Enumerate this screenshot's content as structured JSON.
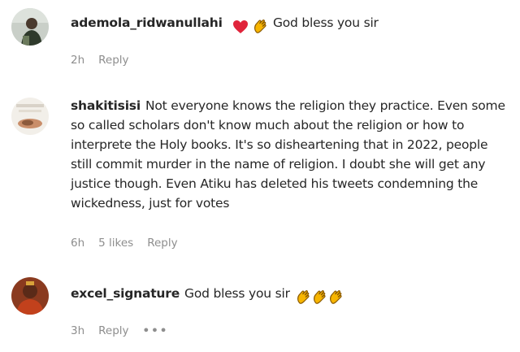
{
  "comments": [
    {
      "username": "ademola_ridwanullahi",
      "text": "God bless you sir",
      "time": "2h",
      "reply": "Reply"
    },
    {
      "username": "shakitisisi",
      "text": "Not everyone knows the religion they practice. Even some so called scholars don't know much about the religion or how to interprete the Holy books. It's so disheartening that in 2022, people still commit murder in the name of religion. I doubt she will get any justice though. Even Atiku has deleted his tweets condemning the wickedness, just for votes",
      "time": "6h",
      "likes": "5 likes",
      "reply": "Reply"
    },
    {
      "username": "excel_signature",
      "text": "God bless you sir",
      "time": "3h",
      "reply": "Reply",
      "more": "•••"
    }
  ],
  "icons": {
    "heart": "heart-emoji",
    "clap": "clapping-hands-emoji"
  },
  "colors": {
    "text": "#262626",
    "muted": "#8e8e8e",
    "heart": "#e0243b",
    "clap": "#f7b500"
  }
}
